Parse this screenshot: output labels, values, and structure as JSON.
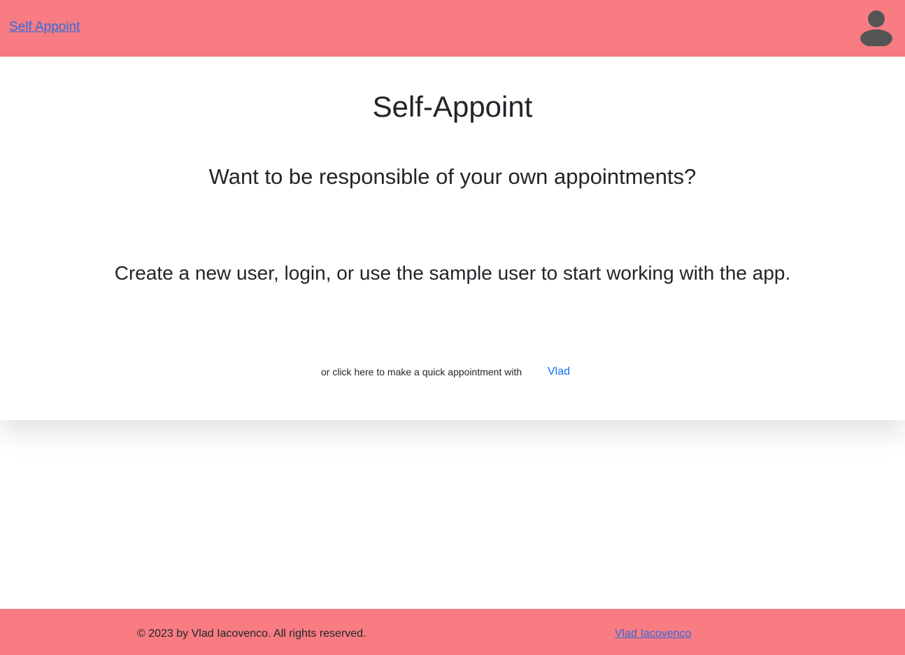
{
  "navbar": {
    "brand": "Self Appoint",
    "avatar_icon": "user-avatar-icon",
    "background": "#f87c82"
  },
  "hero": {
    "title": "Self-Appoint",
    "question": "Want to be responsible of your own appointments?",
    "instructions": "Create a new user, login, or use the sample user to start working with the app.",
    "quick_text": "or click here to make a quick appointment with",
    "quick_link": "Vlad"
  },
  "footer": {
    "copyright": "© 2023 by Vlad Iacovenco. All rights reserved.",
    "author_link": "Vlad Iacovenco"
  },
  "colors": {
    "accent": "#f87c82",
    "link": "#2d6cdf",
    "link_blue": "#0d6efd",
    "avatar": "#555555"
  }
}
